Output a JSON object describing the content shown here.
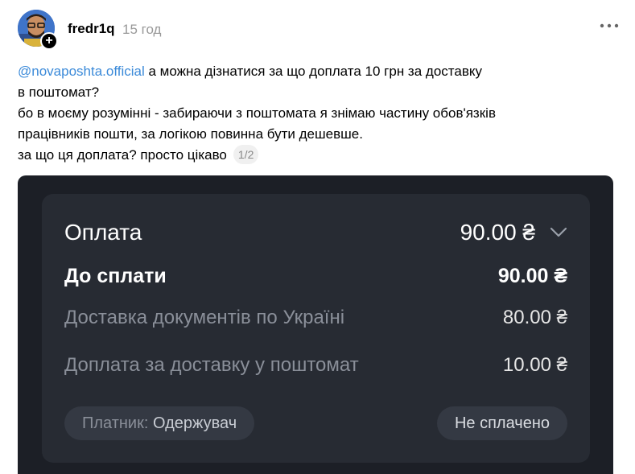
{
  "post": {
    "username": "fredr1q",
    "timestamp": "15 год",
    "more_icon": "more-dots-icon",
    "follow_icon": "plus-icon",
    "mention": "@novaposhta.official",
    "line1_rest": " а можна дізнатися за що доплата 10 грн за доставку",
    "line2": "в поштомат?",
    "line3": "бо в моєму розумінні - забираючи з поштомата я знімаю частину обов'язків",
    "line4": "працівників пошти, за логікою повинна бути дешевше.",
    "line5": "за що ця доплата? просто цікаво",
    "page_counter": "1/2",
    "colors": {
      "mention": "#3b8ad9",
      "muted": "#999999"
    }
  },
  "payment_card": {
    "title": "Оплата",
    "title_value": "90.00 ₴",
    "rows": [
      {
        "label": "До сплати",
        "value": "90.00 ₴"
      },
      {
        "label": "Доставка документів по Україні",
        "value": "80.00 ₴"
      },
      {
        "label": "Доплата за доставку у поштомат",
        "value": "10.00 ₴"
      }
    ],
    "payer_key": "Платник:",
    "payer_value": "Одержувач",
    "status": "Не сплачено",
    "colors": {
      "background": "#1c1f26",
      "panel": "#272b33",
      "chip": "#343943"
    }
  }
}
